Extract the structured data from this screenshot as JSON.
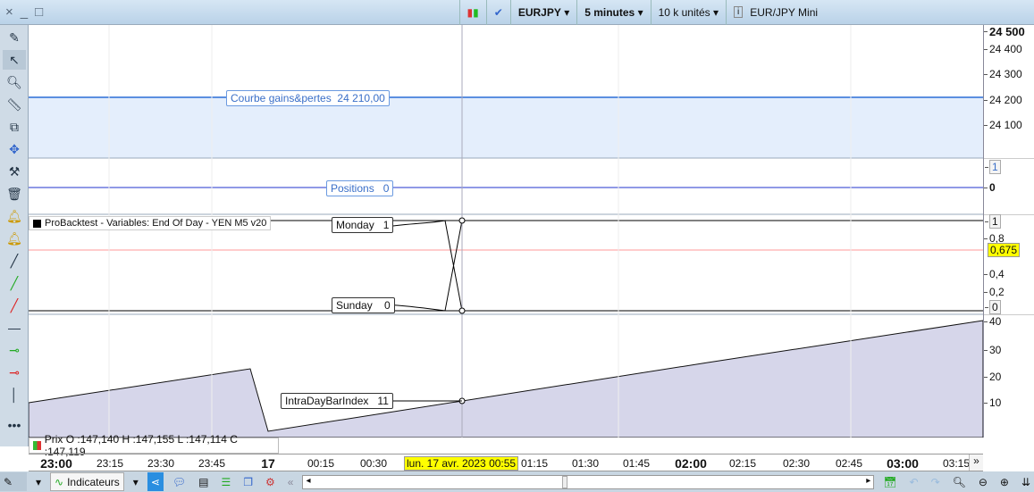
{
  "window": {
    "close": "×",
    "minimize": "_",
    "maximize": "□"
  },
  "toolbar": {
    "symbol": "EURJPY",
    "timeframe": "5 minutes",
    "units": "10 k unités",
    "instrument": "EUR/JPY Mini"
  },
  "panels": {
    "equity": {
      "label": "Courbe gains&pertes",
      "value": "24 210,00",
      "ticks": [
        "24 500",
        "24 400",
        "24 300",
        "24 200",
        "24 100"
      ]
    },
    "positions": {
      "label": "Positions",
      "value": "0",
      "ticks": [
        "1",
        "0"
      ]
    },
    "probacktest": {
      "title": "ProBacktest - Variables: End Of Day - YEN M5 v20",
      "monday": "Monday",
      "monday_val": "1",
      "sunday": "Sunday",
      "sunday_val": "0",
      "ticks": [
        "1",
        "0,8",
        "0,4",
        "0,2",
        "0"
      ],
      "current": "0,675"
    },
    "intraday": {
      "label": "IntraDayBarIndex",
      "value": "11",
      "ticks": [
        "40",
        "30",
        "20",
        "10"
      ]
    }
  },
  "prix": "Prix O :147,140 H :147,155 L :147,114 C :147,119",
  "time_axis": {
    "labels": [
      "23:00",
      "23:15",
      "23:30",
      "23:45",
      "17",
      "00:15",
      "00:30",
      "01:15",
      "01:30",
      "01:45",
      "02:00",
      "02:15",
      "02:30",
      "02:45",
      "03:00",
      "03:15"
    ],
    "cursor": "lun. 17 avr. 2023 00:55"
  },
  "bottom": {
    "indicators": "Indicateurs"
  }
}
